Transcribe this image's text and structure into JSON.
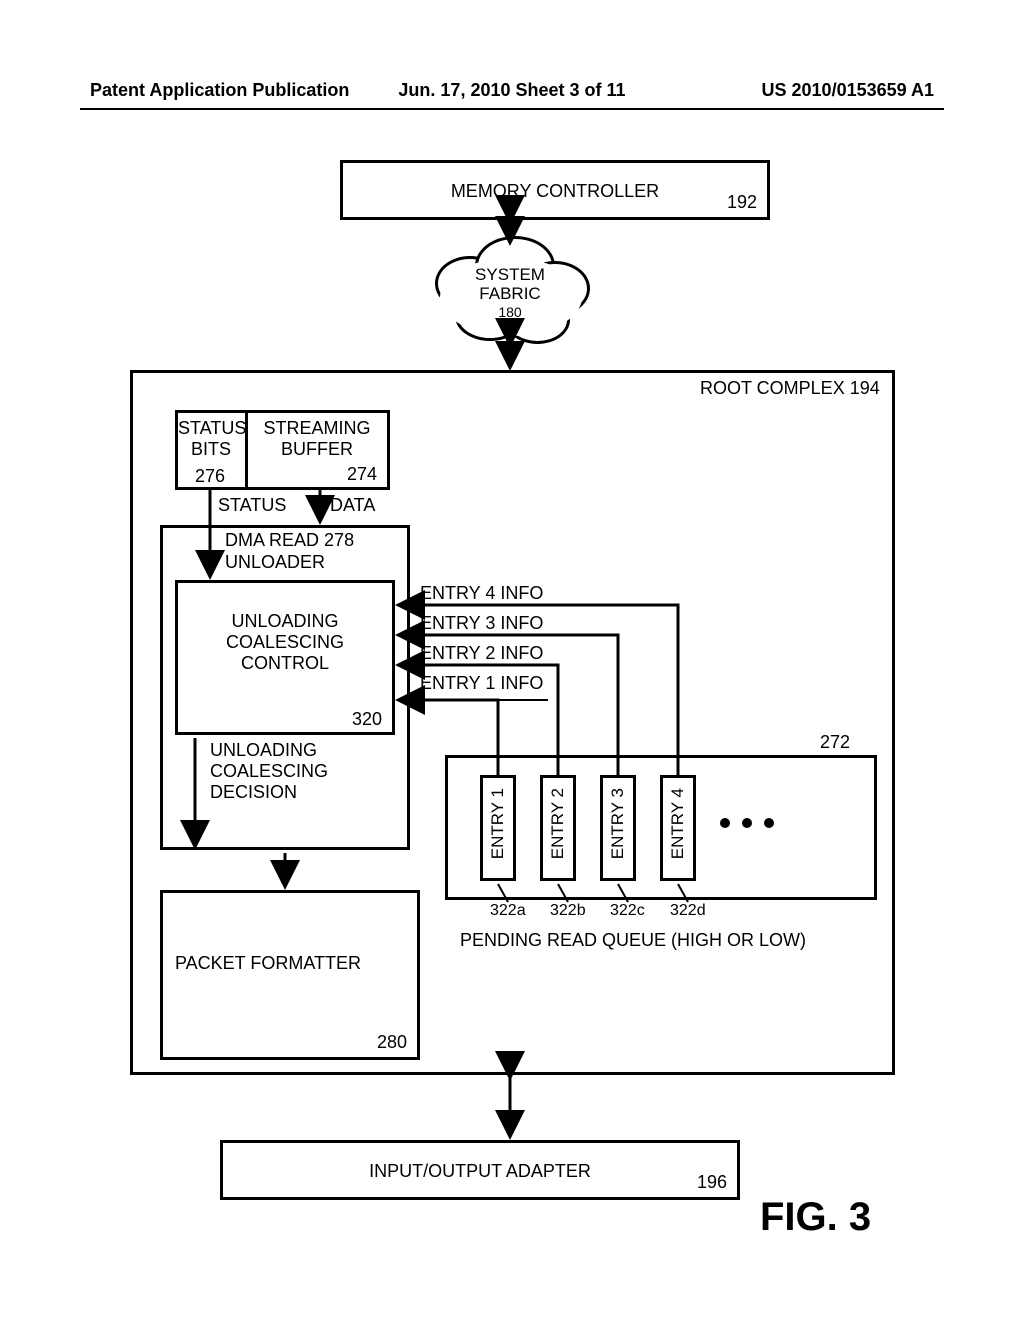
{
  "header": {
    "left": "Patent Application Publication",
    "center": "Jun. 17, 2010  Sheet 3 of 11",
    "right": "US 2010/0153659 A1"
  },
  "figure_label": "FIG. 3",
  "blocks": {
    "memory_controller": {
      "label": "MEMORY CONTROLLER",
      "ref": "192"
    },
    "system_fabric": {
      "label": "SYSTEM\nFABRIC",
      "ref": "180"
    },
    "root_complex": {
      "label": "ROOT COMPLEX",
      "ref": "194"
    },
    "status_bits": {
      "label": "STATUS\nBITS",
      "ref": "276"
    },
    "streaming_buffer": {
      "label": "STREAMING\nBUFFER",
      "ref": "274"
    },
    "dma_read_unloader": {
      "label": "DMA READ",
      "label2": "UNLOADER",
      "ref": "278"
    },
    "unloading_coalescing_control": {
      "label": "UNLOADING\nCOALESCING\nCONTROL",
      "ref": "320"
    },
    "packet_formatter": {
      "label": "PACKET FORMATTER",
      "ref": "280"
    },
    "pending_read_queue": {
      "label": "PENDING READ QUEUE (HIGH OR LOW)",
      "ref": "272"
    },
    "io_adapter": {
      "label": "INPUT/OUTPUT ADAPTER",
      "ref": "196"
    }
  },
  "signals": {
    "status": "STATUS",
    "data": "DATA",
    "unloading_decision": "UNLOADING\nCOALESCING\nDECISION",
    "entry1": "ENTRY 1 INFO",
    "entry2": "ENTRY 2 INFO",
    "entry3": "ENTRY 3 INFO",
    "entry4": "ENTRY 4 INFO"
  },
  "entries": {
    "e1": {
      "label": "ENTRY 1",
      "ref": "322a"
    },
    "e2": {
      "label": "ENTRY 2",
      "ref": "322b"
    },
    "e3": {
      "label": "ENTRY 3",
      "ref": "322c"
    },
    "e4": {
      "label": "ENTRY 4",
      "ref": "322d"
    }
  }
}
